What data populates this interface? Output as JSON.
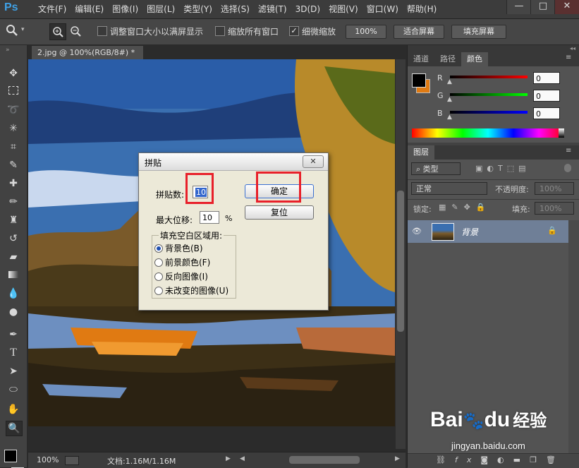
{
  "app": {
    "logo": "Ps",
    "menu": [
      "文件(F)",
      "编辑(E)",
      "图像(I)",
      "图层(L)",
      "类型(Y)",
      "选择(S)",
      "滤镜(T)",
      "3D(D)",
      "视图(V)",
      "窗口(W)",
      "帮助(H)"
    ],
    "window_buttons": [
      "—",
      "□",
      "✕"
    ]
  },
  "options": {
    "resize_windows_label": "调整窗口大小以满屏显示",
    "zoom_all_label": "缩放所有窗口",
    "scrubby_zoom_label": "细微缩放",
    "zoom_100_button": "100%",
    "fit_screen_button": "适合屏幕",
    "fill_screen_button": "填充屏幕"
  },
  "document": {
    "tab_title": "2.jpg @ 100%(RGB/8#) *",
    "tab_close": "×",
    "status_zoom": "100%",
    "status_doc": "文档:1.16M/1.16M"
  },
  "color_panel": {
    "tabs": [
      "通道",
      "路径",
      "颜色"
    ],
    "active_tab": "颜色",
    "channels": [
      {
        "label": "R",
        "value": "0",
        "color": "#ff0000"
      },
      {
        "label": "G",
        "value": "0",
        "color": "#00ff00"
      },
      {
        "label": "B",
        "value": "0",
        "color": "#0000ff"
      }
    ],
    "foreground": "#000000",
    "background": "#e07a12"
  },
  "layers_panel": {
    "tab": "图层",
    "filter_kind": "类型",
    "blend_mode": "正常",
    "opacity_label": "不透明度:",
    "opacity_value": "100%",
    "lock_label": "锁定:",
    "fill_label": "填充:",
    "fill_value": "100%",
    "layers": [
      {
        "name": "背景",
        "locked": true,
        "visible": true
      }
    ],
    "footer_icons": [
      "link-icon",
      "fx-icon",
      "mask-icon",
      "adjustment-icon",
      "folder-icon",
      "new-layer-icon",
      "trash-icon"
    ]
  },
  "dialog": {
    "title": "拼贴",
    "close": "✕",
    "tiles_label": "拼贴数:",
    "tiles_value": "10",
    "offset_label": "最大位移:",
    "offset_value": "10",
    "offset_unit": "%",
    "ok_button": "确定",
    "reset_button": "复位",
    "fill_group_label": "填充空白区域用:",
    "fill_options": [
      "背景色(B)",
      "前景颜色(F)",
      "反向图像(I)",
      "未改变的图像(U)"
    ],
    "fill_selected": 0
  },
  "watermark": {
    "brand": "Bai",
    "brand_du": "du",
    "brand_cn": "经验",
    "url": "jingyan.baidu.com"
  }
}
